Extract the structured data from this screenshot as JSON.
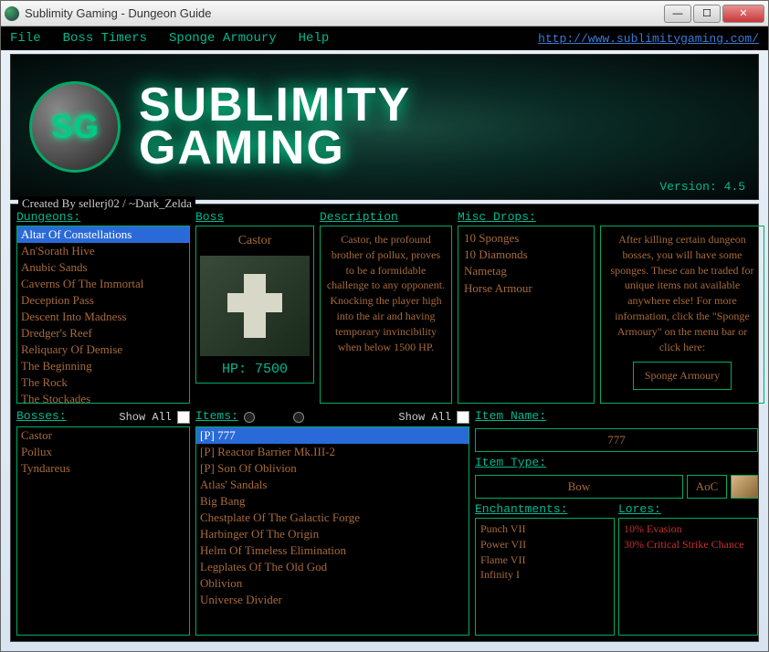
{
  "window": {
    "title": "Sublimity Gaming - Dungeon Guide"
  },
  "menu": {
    "file": "File",
    "timers": "Boss Timers",
    "armoury": "Sponge Armoury",
    "help": "Help",
    "url": "http://www.sublimitygaming.com/"
  },
  "banner": {
    "logo_abbrev": "SG",
    "line1": "SUBLIMITY",
    "line2": "GAMING",
    "version": "Version: 4.5"
  },
  "created_by": "Created By sellerj02 / ~Dark_Zelda",
  "labels": {
    "dungeons": "Dungeons:",
    "boss": "Boss",
    "description": "Description",
    "misc_drops": "Misc Drops:",
    "bosses": "Bosses:",
    "items": "Items:",
    "item_name": "Item Name:",
    "item_type": "Item Type:",
    "enchantments": "Enchantments:",
    "lores": "Lores:",
    "show_all": "Show All",
    "sponge_btn": "Sponge Armoury",
    "hp_label": "HP: 7500"
  },
  "dungeons": [
    "Altar Of Constellations",
    "An'Sorath Hive",
    "Anubic Sands",
    "Caverns Of The Immortal",
    "Deception Pass",
    "Descent Into Madness",
    "Dredger's Reef",
    "Reliquary Of Demise",
    "The Beginning",
    "The Rock",
    "The Stockades"
  ],
  "dungeon_selected": 0,
  "boss": {
    "name": "Castor",
    "description": "Castor, the profound brother of pollux, proves to be a formidable challenge to any opponent. Knocking the player high into the air and having temporary invincibility when below 1500 HP."
  },
  "misc_drops": [
    "10 Sponges",
    "10 Diamonds",
    "Nametag",
    "Horse Armour"
  ],
  "sponge_info": "After killing certain dungeon bosses, you will have some sponges. These can be traded for unique items not available anywhere else! For more information, click the \"Sponge Armoury\" on the menu bar or click here:",
  "bosses": [
    "Castor",
    "Pollux",
    "Tyndareus"
  ],
  "items": [
    "[P] 777",
    "[P] Reactor Barrier Mk.III-2",
    "[P] Son Of Oblivion",
    "Atlas' Sandals",
    "Big Bang",
    "Chestplate Of The Galactic Forge",
    "Harbinger Of The Origin",
    "Helm Of Timeless Elimination",
    "Legplates Of The Old God",
    "Oblivion",
    "Universe Divider"
  ],
  "item_selected": 0,
  "item_detail": {
    "name": "777",
    "type": "Bow",
    "set": "AoC"
  },
  "enchantments": [
    "Punch VII",
    "Power VII",
    "Flame VII",
    "Infinity I"
  ],
  "lores": [
    "10% Evasion",
    "30% Critical Strike Chance"
  ]
}
